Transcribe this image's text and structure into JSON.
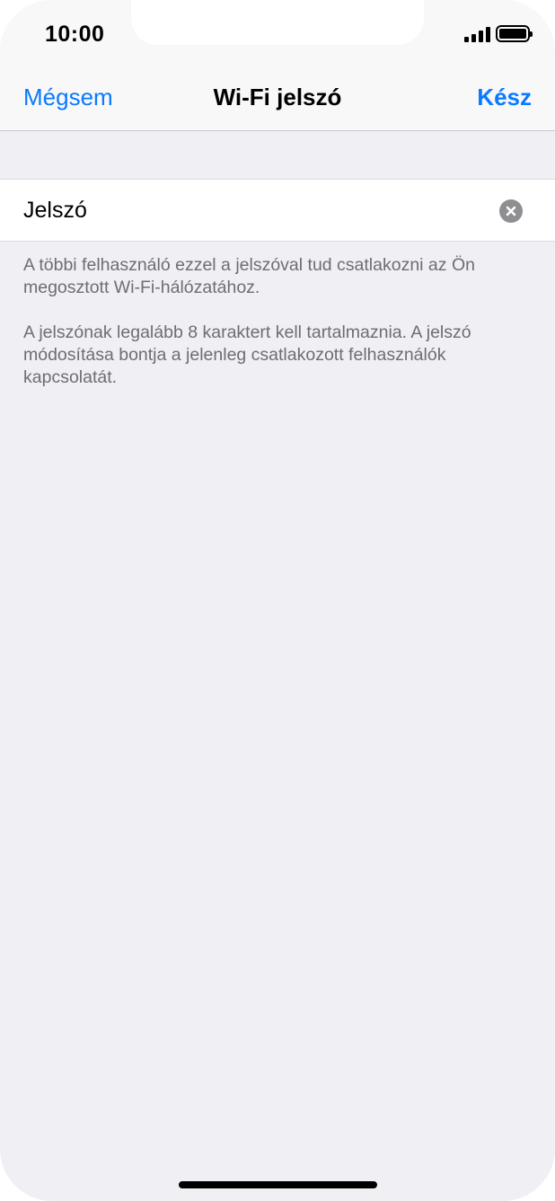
{
  "status_bar": {
    "time": "10:00",
    "signal_icon": "cellular-signal-icon",
    "battery_icon": "battery-full-icon"
  },
  "nav": {
    "cancel_label": "Mégsem",
    "title": "Wi-Fi jelszó",
    "done_label": "Kész"
  },
  "password_field": {
    "value": "",
    "placeholder": "Jelszó",
    "clear_icon": "clear-circle-icon"
  },
  "footer": {
    "text_1": "A többi felhasználó ezzel a jelszóval tud csatlakozni az Ön megosztott Wi-Fi-hálózatához.",
    "text_2": "A jelszónak legalább 8 karaktert kell tartalmaznia. A jelszó módosítása bontja a jelenleg csatlakozott felhasználók kapcsolatát."
  },
  "colors": {
    "accent": "#0a7aff",
    "background": "#efeff4",
    "footer_text": "#6d6d72"
  }
}
